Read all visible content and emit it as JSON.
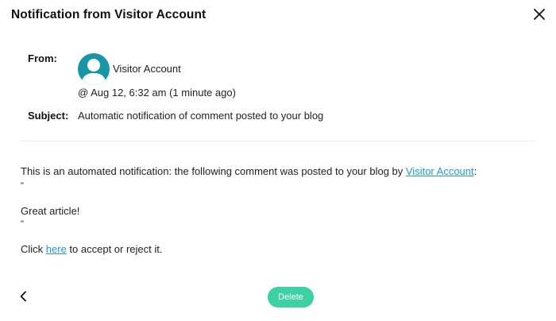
{
  "dialog": {
    "title": "Notification from Visitor Account"
  },
  "header": {
    "from_label": "From:",
    "sender_name": "Visitor Account",
    "timestamp": "@ Aug 12, 6:32 am (1 minute ago)",
    "subject_label": "Subject:",
    "subject": "Automatic notification of comment posted to your blog"
  },
  "message": {
    "intro_prefix": "This is an automated notification: the following comment was posted to your blog by ",
    "intro_link": "Visitor Account",
    "intro_suffix": ":",
    "quote_open": "\"",
    "comment": "Great article!",
    "quote_close": "\"",
    "action_prefix": "Click ",
    "action_link": "here",
    "action_suffix": " to accept or reject it."
  },
  "footer": {
    "delete_label": "Delete"
  },
  "colors": {
    "accent": "#3dd1a2",
    "link": "#1a9bd7",
    "avatar": "#1995a8"
  },
  "icons": {
    "close": "close-icon",
    "back": "chevron-left-icon",
    "avatar": "user-avatar-icon"
  }
}
